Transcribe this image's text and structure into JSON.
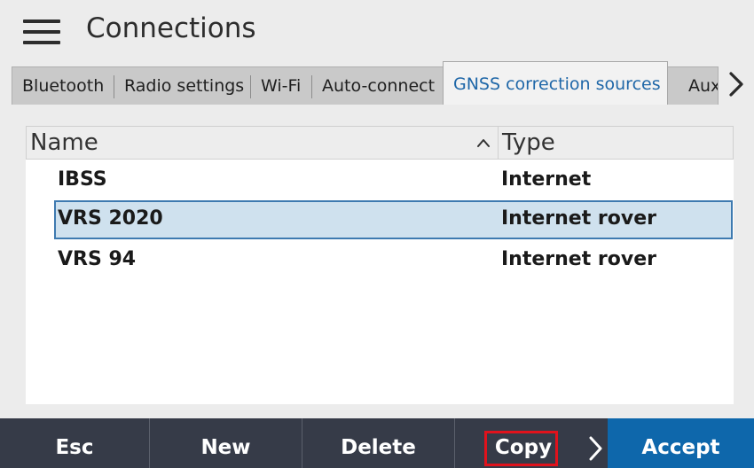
{
  "header": {
    "title": "Connections",
    "menu_icon": "hamburger-menu-icon"
  },
  "tabs": {
    "items": [
      {
        "label": "Bluetooth",
        "active": false
      },
      {
        "label": "Radio settings",
        "active": false
      },
      {
        "label": "Wi-Fi",
        "active": false
      },
      {
        "label": "Auto-connect",
        "active": false
      },
      {
        "label": "GNSS correction sources",
        "active": true
      },
      {
        "label": "Auxil",
        "active": false
      }
    ],
    "next_icon": "chevron-right-icon"
  },
  "table": {
    "columns": {
      "name": "Name",
      "type": "Type",
      "sort_icon": "sort-ascending-icon"
    },
    "rows": [
      {
        "name": "IBSS",
        "type": "Internet",
        "selected": false
      },
      {
        "name": "VRS 2020",
        "type": "Internet rover",
        "selected": true
      },
      {
        "name": "VRS 94",
        "type": "Internet rover",
        "selected": false
      }
    ]
  },
  "softkeys": {
    "esc": "Esc",
    "new": "New",
    "delete": "Delete",
    "copy": "Copy",
    "more_icon": "chevron-right-icon",
    "accept": "Accept"
  },
  "colors": {
    "active_tab_text": "#1f67a8",
    "selection_fill": "#cfe1ee",
    "selection_border": "#3e7ab0",
    "softbar_bg": "#363b48",
    "accept_bg": "#0e67ab",
    "highlight_box": "#e0121c"
  }
}
